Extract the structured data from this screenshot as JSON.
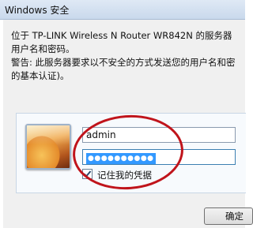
{
  "window": {
    "title": "Windows 安全"
  },
  "dialog": {
    "message_line1": "位于 TP-LINK Wireless N Router WR842N 的服务器",
    "message_line2": "用户名和密码。",
    "warning_line1": "警告: 此服务器要求以不安全的方式发送您的用户名和密",
    "warning_line2": "的基本认证)。"
  },
  "credentials": {
    "username": "admin",
    "password_mask": "●●●●●●●●●●",
    "remember_label": "记住我的凭据",
    "remember_checked": true
  },
  "buttons": {
    "ok_label": "确定"
  },
  "annotation": {
    "ring_color": "#c0141b"
  }
}
